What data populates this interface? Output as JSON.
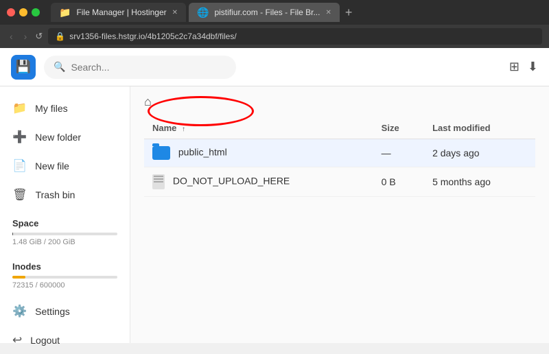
{
  "titlebar": {
    "tab1_label": "File Manager | Hostinger",
    "tab2_label": "pistifiur.com - Files - File Br...",
    "new_tab_label": "+"
  },
  "addressbar": {
    "url": "srv1356-files.hstgr.io/4b1205c2c7a34dbf/files/"
  },
  "header": {
    "search_placeholder": "Search...",
    "logo_icon": "💾"
  },
  "sidebar": {
    "my_files": "My files",
    "new_folder": "New folder",
    "new_file": "New file",
    "trash_bin": "Trash bin",
    "space_label": "Space",
    "space_value": "1.48 GiB / 200 GiB",
    "inodes_label": "Inodes",
    "inodes_value": "72315 / 600000",
    "settings": "Settings",
    "logout": "Logout"
  },
  "content": {
    "columns": {
      "name": "Name",
      "size": "Size",
      "last_modified": "Last modified"
    },
    "files": [
      {
        "name": "public_html",
        "type": "folder",
        "size": "—",
        "last_modified": "2 days ago"
      },
      {
        "name": "DO_NOT_UPLOAD_HERE",
        "type": "file",
        "size": "0 B",
        "last_modified": "5 months ago"
      }
    ]
  }
}
